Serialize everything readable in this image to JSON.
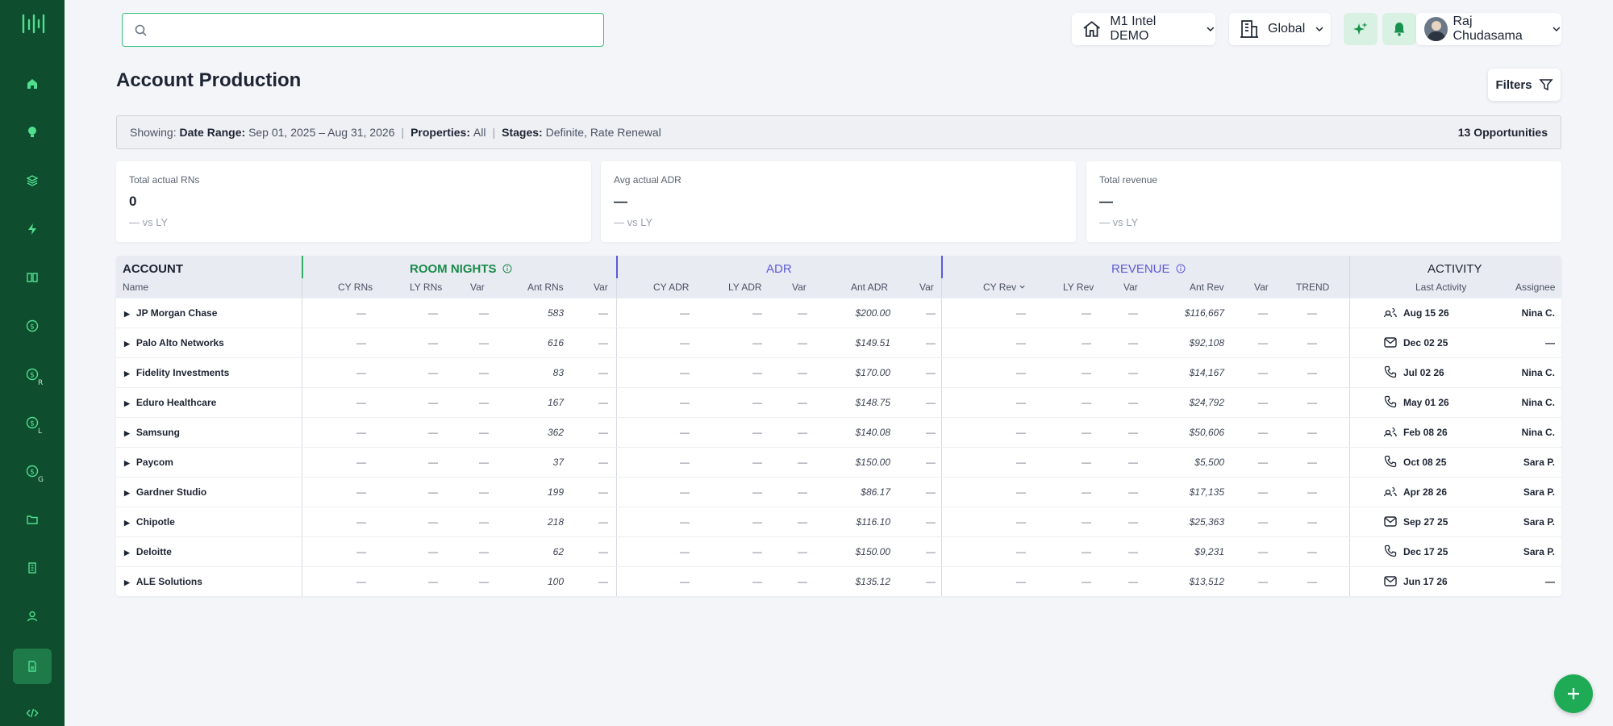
{
  "colors": {
    "sidebar": "#0e4d2d",
    "accent_green": "#1faa56",
    "room_nights": "#1a8a4a",
    "adr": "#5b5bd6",
    "revenue": "#5b5bd6"
  },
  "sidebar": {
    "logo": "brand-logo",
    "items": [
      {
        "icon": "home-icon"
      },
      {
        "icon": "lightbulb-icon"
      },
      {
        "icon": "layers-icon"
      },
      {
        "icon": "bolt-icon"
      },
      {
        "icon": "book-icon"
      },
      {
        "icon": "dollar-icon"
      },
      {
        "icon": "dollar-r-icon",
        "sub": "R"
      },
      {
        "icon": "dollar-l-icon",
        "sub": "L"
      },
      {
        "icon": "dollar-g-icon",
        "sub": "G"
      },
      {
        "icon": "folder-icon"
      },
      {
        "icon": "building-icon"
      },
      {
        "icon": "user-icon"
      },
      {
        "icon": "report-icon"
      },
      {
        "icon": "code-icon"
      }
    ]
  },
  "topbar": {
    "search_placeholder": "",
    "org": "M1 Intel DEMO",
    "scope": "Global",
    "user_name": "Raj Chudasama"
  },
  "page": {
    "title": "Account Production",
    "filters_label": "Filters"
  },
  "summary": {
    "showing_label": "Showing:",
    "date_range_label": "Date Range:",
    "date_range": "Sep 01, 2025 – Aug 31, 2026",
    "properties_label": "Properties:",
    "properties": "All",
    "stages_label": "Stages:",
    "stages": "Definite, Rate Renewal",
    "opportunities": "13 Opportunities"
  },
  "kpis": [
    {
      "label": "Total actual RNs",
      "value": "0",
      "ly": "— vs LY"
    },
    {
      "label": "Avg actual ADR",
      "value": "—",
      "ly": "— vs LY"
    },
    {
      "label": "Total revenue",
      "value": "—",
      "ly": "— vs LY"
    }
  ],
  "table": {
    "groups": {
      "account": "ACCOUNT",
      "room_nights": "ROOM NIGHTS",
      "adr": "ADR",
      "revenue": "REVENUE",
      "activity": "ACTIVITY"
    },
    "columns": {
      "name": "Name",
      "cy_rns": "CY RNs",
      "ly_rns": "LY RNs",
      "var1": "Var",
      "ant_rns": "Ant RNs",
      "var2": "Var",
      "cy_adr": "CY ADR",
      "ly_adr": "LY ADR",
      "var3": "Var",
      "ant_adr": "Ant ADR",
      "var4": "Var",
      "cy_rev": "CY Rev",
      "ly_rev": "LY Rev",
      "var5": "Var",
      "ant_rev": "Ant Rev",
      "var6": "Var",
      "trend": "TREND",
      "last_activity": "Last Activity",
      "assignee": "Assignee"
    },
    "dash": "—",
    "rows": [
      {
        "name": "JP Morgan Chase",
        "ant_rns": "583",
        "ant_adr": "$200.00",
        "ant_rev": "$116,667",
        "activity_icon": "people-icon",
        "last_activity": "Aug 15 26",
        "assignee": "Nina C."
      },
      {
        "name": "Palo Alto Networks",
        "ant_rns": "616",
        "ant_adr": "$149.51",
        "ant_rev": "$92,108",
        "activity_icon": "mail-icon",
        "last_activity": "Dec 02 25",
        "assignee": "—"
      },
      {
        "name": "Fidelity Investments",
        "ant_rns": "83",
        "ant_adr": "$170.00",
        "ant_rev": "$14,167",
        "activity_icon": "phone-icon",
        "last_activity": "Jul 02 26",
        "assignee": "Nina C."
      },
      {
        "name": "Eduro Healthcare",
        "ant_rns": "167",
        "ant_adr": "$148.75",
        "ant_rev": "$24,792",
        "activity_icon": "phone-icon",
        "last_activity": "May 01 26",
        "assignee": "Nina C."
      },
      {
        "name": "Samsung",
        "ant_rns": "362",
        "ant_adr": "$140.08",
        "ant_rev": "$50,606",
        "activity_icon": "people-icon",
        "last_activity": "Feb 08 26",
        "assignee": "Nina C."
      },
      {
        "name": "Paycom",
        "ant_rns": "37",
        "ant_adr": "$150.00",
        "ant_rev": "$5,500",
        "activity_icon": "phone-icon",
        "last_activity": "Oct 08 25",
        "assignee": "Sara P."
      },
      {
        "name": "Gardner Studio",
        "ant_rns": "199",
        "ant_adr": "$86.17",
        "ant_rev": "$17,135",
        "activity_icon": "people-icon",
        "last_activity": "Apr 28 26",
        "assignee": "Sara P."
      },
      {
        "name": "Chipotle",
        "ant_rns": "218",
        "ant_adr": "$116.10",
        "ant_rev": "$25,363",
        "activity_icon": "mail-icon",
        "last_activity": "Sep 27 25",
        "assignee": "Sara P."
      },
      {
        "name": "Deloitte",
        "ant_rns": "62",
        "ant_adr": "$150.00",
        "ant_rev": "$9,231",
        "activity_icon": "phone-icon",
        "last_activity": "Dec 17 25",
        "assignee": "Sara P."
      },
      {
        "name": "ALE Solutions",
        "ant_rns": "100",
        "ant_adr": "$135.12",
        "ant_rev": "$13,512",
        "activity_icon": "mail-icon",
        "last_activity": "Jun 17 26",
        "assignee": "—"
      }
    ]
  },
  "fab": {
    "icon": "plus-icon"
  }
}
